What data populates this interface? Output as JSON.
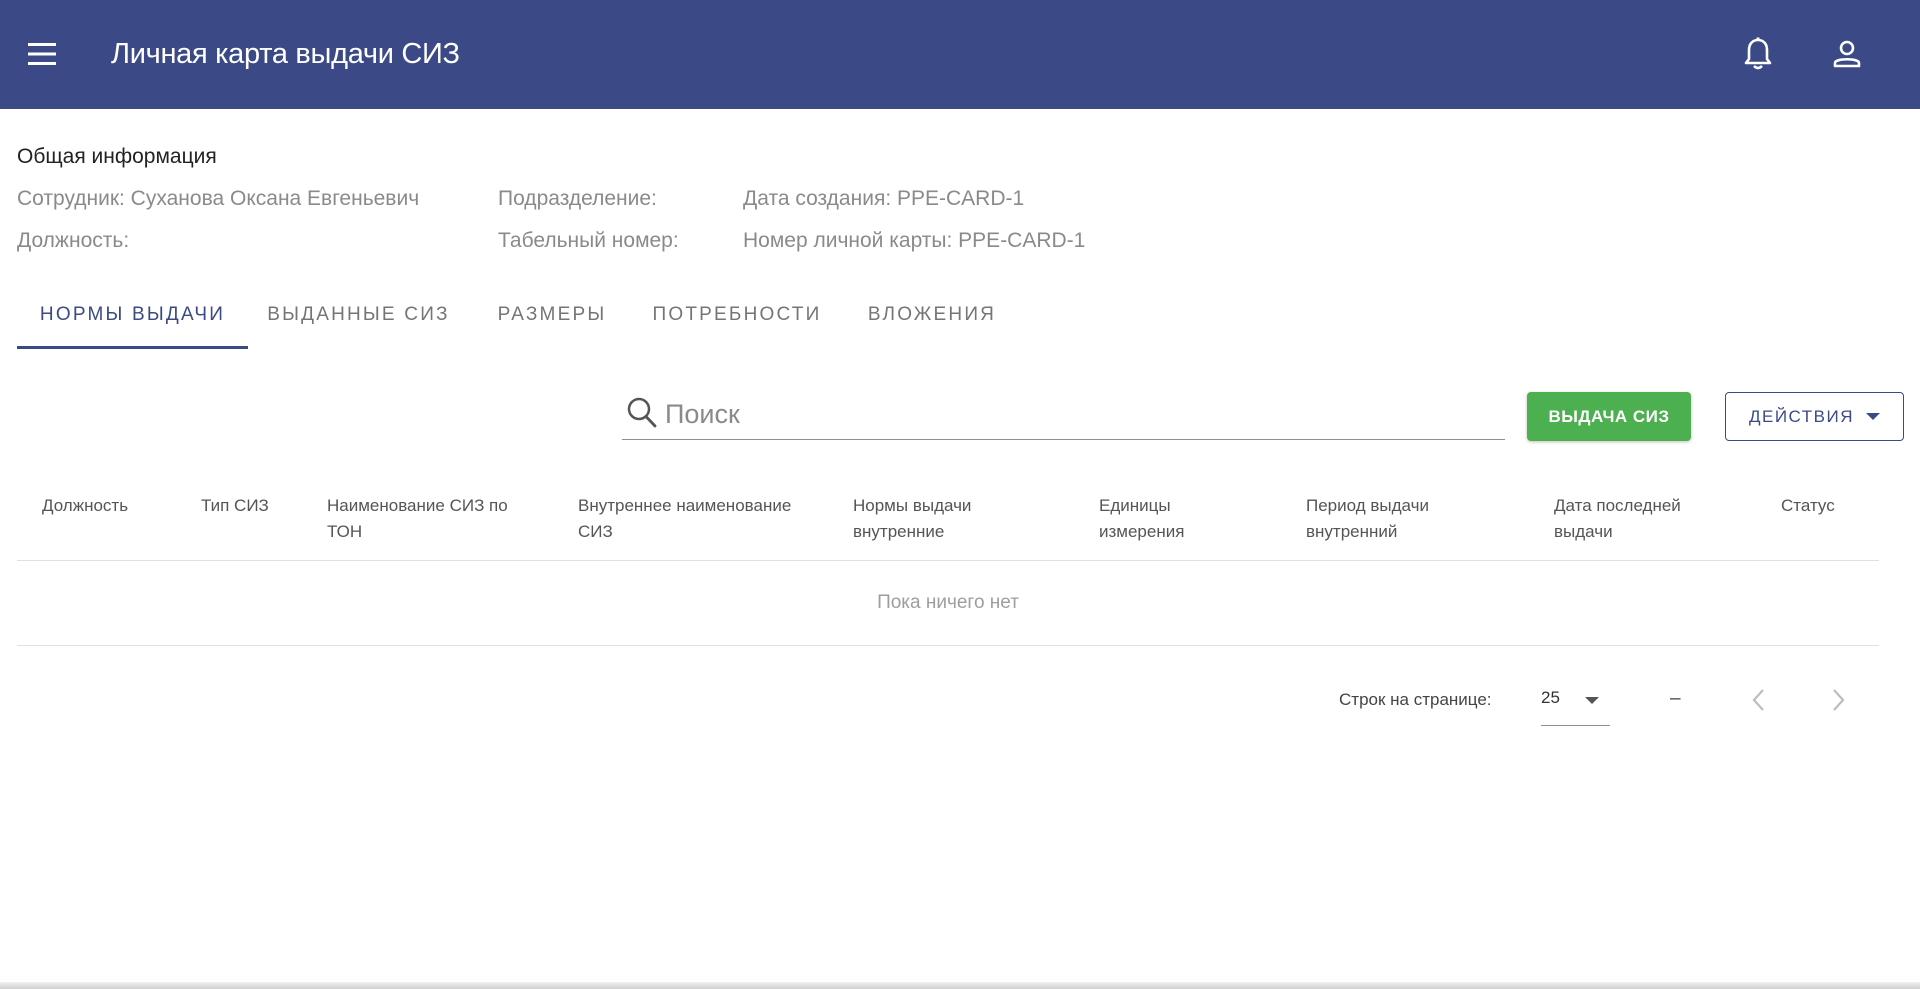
{
  "appbar": {
    "title": "Личная карта выдачи СИЗ",
    "color": "#3b4a86",
    "icons": [
      "menu-icon",
      "bell-icon",
      "account-icon"
    ]
  },
  "general": {
    "section_title": "Общая информация",
    "employee": "Сотрудник: Суханова Оксана Евгеньевич",
    "position": "Должность:",
    "department": "Подразделение:",
    "personnel_number": "Табельный номер:",
    "creation_date": "Дата создания: PPE-CARD-1",
    "card_number": "Номер личной карты: PPE-CARD-1"
  },
  "tabs": [
    {
      "label": "Нормы выдачи",
      "active": true
    },
    {
      "label": "Выданные СИЗ",
      "active": false
    },
    {
      "label": "Размеры",
      "active": false
    },
    {
      "label": "Потребности",
      "active": false
    },
    {
      "label": "Вложения",
      "active": false
    }
  ],
  "toolbar": {
    "search_placeholder": "Поиск",
    "search_value": "",
    "issue_button": "ВЫДАЧА СИЗ",
    "issue_color": "#4caf50",
    "actions_button": "ДЕЙСТВИЯ"
  },
  "table": {
    "columns": [
      "Должность",
      "Тип СИЗ",
      "Наименование СИЗ по ТОН",
      "Внутреннее наименование СИЗ",
      "Нормы выдачи внутренние",
      "Единицы измерения",
      "Период выдачи внутренний",
      "Дата последней выдачи",
      "Статус"
    ],
    "empty_text": "Пока ничего нет"
  },
  "pagination": {
    "rows_label": "Строк на странице:",
    "rows_per_page": "25",
    "range": "–"
  }
}
